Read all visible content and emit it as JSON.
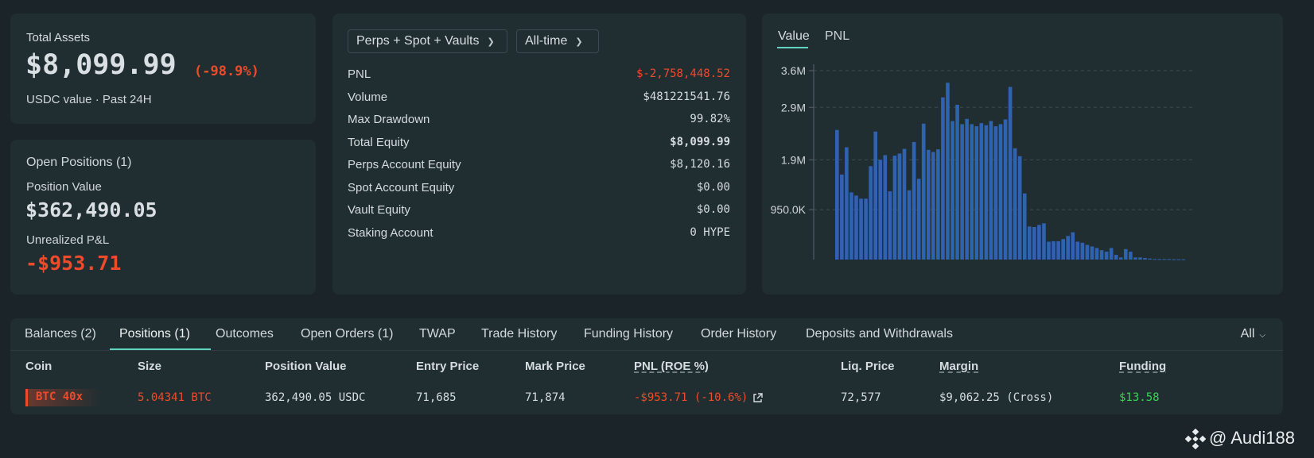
{
  "assets": {
    "label": "Total Assets",
    "value": "$8,099.99",
    "change": "(-98.9%)",
    "subtitle": "USDC value · Past 24H"
  },
  "open_positions": {
    "title": "Open Positions (1)",
    "position_value_label": "Position Value",
    "position_value": "$362,490.05",
    "unrealized_label": "Unrealized P&L",
    "unrealized_value": "-$953.71"
  },
  "stats": {
    "scope_dropdown": "Perps + Spot + Vaults",
    "range_dropdown": "All-time",
    "rows": [
      {
        "label": "PNL",
        "value": "$-2,758,448.52",
        "color": "#ed4b2c"
      },
      {
        "label": "Volume",
        "value": "$481221541.76"
      },
      {
        "label": "Max Drawdown",
        "value": "99.82%"
      },
      {
        "label": "Total Equity",
        "value": "$8,099.99",
        "bold": true
      },
      {
        "label": "Perps Account Equity",
        "value": "$8,120.16"
      },
      {
        "label": "Spot Account Equity",
        "value": "$0.00"
      },
      {
        "label": "Vault Equity",
        "value": "$0.00"
      },
      {
        "label": "Staking Account",
        "value": "0 HYPE"
      }
    ]
  },
  "chart_tabs": {
    "value": "Value",
    "pnl": "PNL",
    "active": "Value"
  },
  "chart_data": {
    "type": "bar",
    "series_color": "#2f62b0",
    "y_ticks": [
      {
        "value": 3600000,
        "label": "3.6M"
      },
      {
        "value": 2900000,
        "label": "2.9M"
      },
      {
        "value": 1900000,
        "label": "1.9M"
      },
      {
        "value": 950000,
        "label": "950.0K"
      }
    ],
    "ylim": [
      0,
      3700000
    ],
    "grid": true,
    "values": [
      2470000,
      1620000,
      2140000,
      1280000,
      1220000,
      1160000,
      1160000,
      1780000,
      2440000,
      1900000,
      1990000,
      1300000,
      1980000,
      2020000,
      2110000,
      1320000,
      2240000,
      1540000,
      2590000,
      2090000,
      2050000,
      2100000,
      3090000,
      3370000,
      2640000,
      2950000,
      2580000,
      2680000,
      2580000,
      2540000,
      2600000,
      2560000,
      2640000,
      2540000,
      2580000,
      2670000,
      3290000,
      2120000,
      1970000,
      1260000,
      630000,
      620000,
      660000,
      690000,
      340000,
      350000,
      350000,
      390000,
      450000,
      520000,
      340000,
      320000,
      280000,
      250000,
      220000,
      180000,
      150000,
      220000,
      90000,
      40000,
      200000,
      150000,
      40000,
      40000,
      30000,
      20000,
      10000,
      10000,
      10000,
      10000,
      5000,
      5000,
      5000
    ]
  },
  "bottom": {
    "tabs": [
      "Balances (2)",
      "Positions (1)",
      "Outcomes",
      "Open Orders (1)",
      "TWAP",
      "Trade History",
      "Funding History",
      "Order History",
      "Deposits and Withdrawals"
    ],
    "active_tab": "Positions (1)",
    "filter": "All",
    "columns": [
      "Coin",
      "Size",
      "Position Value",
      "Entry Price",
      "Mark Price",
      "PNL (ROE %)",
      "Liq. Price",
      "Margin",
      "Funding"
    ],
    "row": {
      "coin": "BTC 40x",
      "size": "5.04341 BTC",
      "position_value": "362,490.05 USDC",
      "entry_price": "71,685",
      "mark_price": "71,874",
      "pnl": "-$953.71 (-10.6%)",
      "liq_price": "72,577",
      "margin": "$9,062.25 (Cross)",
      "funding": "$13.58"
    }
  },
  "watermark": "@ Audi188"
}
